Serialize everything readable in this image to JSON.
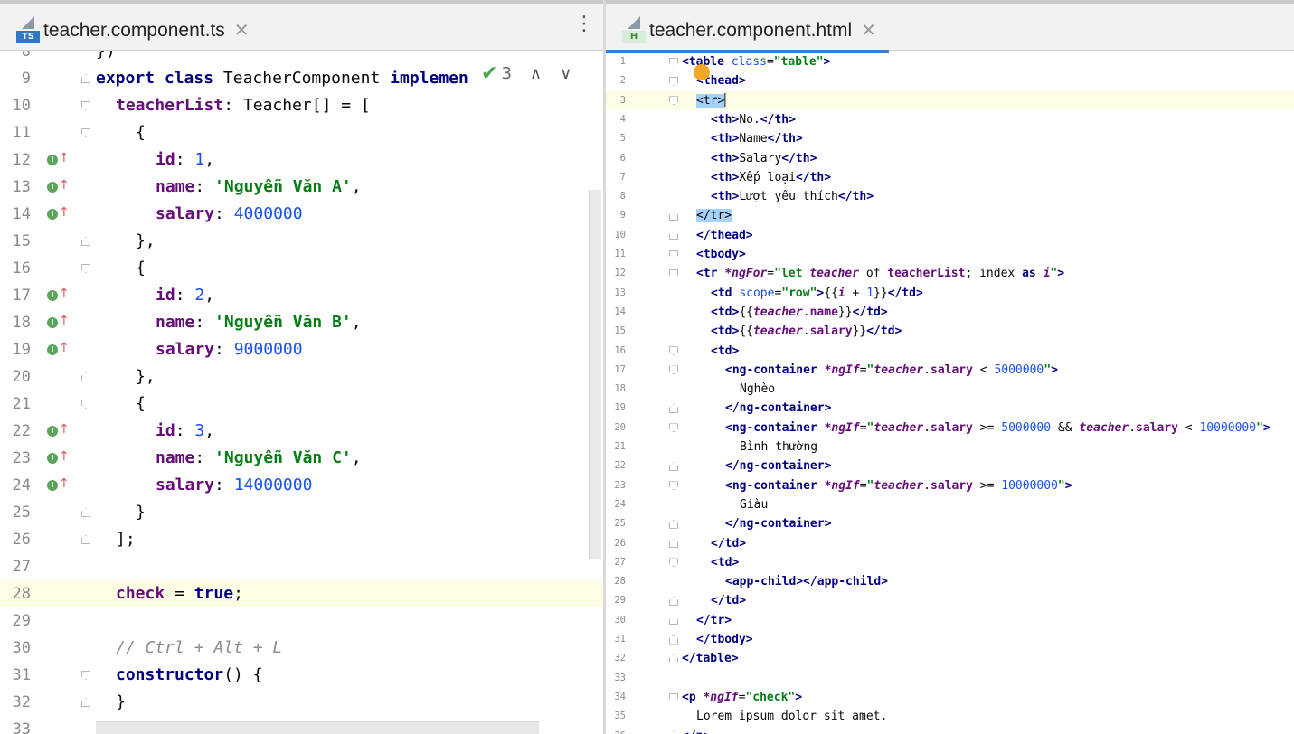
{
  "left": {
    "tab": {
      "icon_label": "TS",
      "name": "teacher.component.ts",
      "close": "✕"
    },
    "inspections": {
      "count": "3"
    },
    "lines": [
      {
        "n": "8",
        "fold": "",
        "impl": false,
        "indent": 0,
        "tokens": [
          [
            "plain",
            "})"
          ]
        ]
      },
      {
        "n": "9",
        "fold": "end",
        "impl": false,
        "indent": 0,
        "tokens": [
          [
            "kw",
            "export"
          ],
          [
            "plain",
            " "
          ],
          [
            "kw",
            "class"
          ],
          [
            "plain",
            " TeacherComponent "
          ],
          [
            "kw",
            "implemen"
          ]
        ]
      },
      {
        "n": "10",
        "fold": "start",
        "impl": false,
        "indent": 1,
        "tokens": [
          [
            "prop",
            "teacherList"
          ],
          [
            "plain",
            ": Teacher[] = ["
          ]
        ]
      },
      {
        "n": "11",
        "fold": "start",
        "impl": false,
        "indent": 2,
        "tokens": [
          [
            "plain",
            "{"
          ]
        ]
      },
      {
        "n": "12",
        "fold": "",
        "impl": true,
        "indent": 3,
        "tokens": [
          [
            "prop",
            "id"
          ],
          [
            "plain",
            ": "
          ],
          [
            "num-l",
            "1"
          ],
          [
            "plain",
            ","
          ]
        ]
      },
      {
        "n": "13",
        "fold": "",
        "impl": true,
        "indent": 3,
        "tokens": [
          [
            "prop",
            "name"
          ],
          [
            "plain",
            ": "
          ],
          [
            "str",
            "'Nguyễn Văn A'"
          ],
          [
            "plain",
            ","
          ]
        ]
      },
      {
        "n": "14",
        "fold": "",
        "impl": true,
        "indent": 3,
        "tokens": [
          [
            "prop",
            "salary"
          ],
          [
            "plain",
            ": "
          ],
          [
            "num-l",
            "4000000"
          ]
        ]
      },
      {
        "n": "15",
        "fold": "end",
        "impl": false,
        "indent": 2,
        "tokens": [
          [
            "plain",
            "},"
          ]
        ]
      },
      {
        "n": "16",
        "fold": "start",
        "impl": false,
        "indent": 2,
        "tokens": [
          [
            "plain",
            "{"
          ]
        ]
      },
      {
        "n": "17",
        "fold": "",
        "impl": true,
        "indent": 3,
        "tokens": [
          [
            "prop",
            "id"
          ],
          [
            "plain",
            ": "
          ],
          [
            "num-l",
            "2"
          ],
          [
            "plain",
            ","
          ]
        ]
      },
      {
        "n": "18",
        "fold": "",
        "impl": true,
        "indent": 3,
        "tokens": [
          [
            "prop",
            "name"
          ],
          [
            "plain",
            ": "
          ],
          [
            "str",
            "'Nguyễn Văn B'"
          ],
          [
            "plain",
            ","
          ]
        ]
      },
      {
        "n": "19",
        "fold": "",
        "impl": true,
        "indent": 3,
        "tokens": [
          [
            "prop",
            "salary"
          ],
          [
            "plain",
            ": "
          ],
          [
            "num-l",
            "9000000"
          ]
        ]
      },
      {
        "n": "20",
        "fold": "end",
        "impl": false,
        "indent": 2,
        "tokens": [
          [
            "plain",
            "},"
          ]
        ]
      },
      {
        "n": "21",
        "fold": "start",
        "impl": false,
        "indent": 2,
        "tokens": [
          [
            "plain",
            "{"
          ]
        ]
      },
      {
        "n": "22",
        "fold": "",
        "impl": true,
        "indent": 3,
        "tokens": [
          [
            "prop",
            "id"
          ],
          [
            "plain",
            ": "
          ],
          [
            "num-l",
            "3"
          ],
          [
            "plain",
            ","
          ]
        ]
      },
      {
        "n": "23",
        "fold": "",
        "impl": true,
        "indent": 3,
        "tokens": [
          [
            "prop",
            "name"
          ],
          [
            "plain",
            ": "
          ],
          [
            "str",
            "'Nguyễn Văn C'"
          ],
          [
            "plain",
            ","
          ]
        ]
      },
      {
        "n": "24",
        "fold": "",
        "impl": true,
        "indent": 3,
        "tokens": [
          [
            "prop",
            "salary"
          ],
          [
            "plain",
            ": "
          ],
          [
            "num-l",
            "14000000"
          ]
        ]
      },
      {
        "n": "25",
        "fold": "end",
        "impl": false,
        "indent": 2,
        "tokens": [
          [
            "plain",
            "}"
          ]
        ]
      },
      {
        "n": "26",
        "fold": "end",
        "impl": false,
        "indent": 1,
        "tokens": [
          [
            "plain",
            "];"
          ]
        ]
      },
      {
        "n": "27",
        "fold": "",
        "impl": false,
        "indent": 0,
        "tokens": []
      },
      {
        "n": "28",
        "fold": "",
        "impl": false,
        "indent": 1,
        "current": true,
        "tokens": [
          [
            "prop",
            "check"
          ],
          [
            "plain",
            " = "
          ],
          [
            "kw",
            "true"
          ],
          [
            "plain",
            ";"
          ]
        ]
      },
      {
        "n": "29",
        "fold": "",
        "impl": false,
        "indent": 0,
        "tokens": []
      },
      {
        "n": "30",
        "fold": "",
        "impl": false,
        "indent": 1,
        "tokens": [
          [
            "cmt",
            "// Ctrl + Alt + L"
          ]
        ]
      },
      {
        "n": "31",
        "fold": "start",
        "impl": false,
        "indent": 1,
        "tokens": [
          [
            "kw",
            "constructor"
          ],
          [
            "plain",
            "() {"
          ]
        ]
      },
      {
        "n": "32",
        "fold": "end",
        "impl": false,
        "indent": 1,
        "tokens": [
          [
            "plain",
            "}"
          ]
        ]
      },
      {
        "n": "33",
        "fold": "",
        "impl": false,
        "indent": 0,
        "tokens": []
      }
    ]
  },
  "right": {
    "tab": {
      "icon_label": "H",
      "name": "teacher.component.html",
      "close": "✕"
    },
    "lines": [
      {
        "n": "1",
        "fold": "start",
        "indent": 0,
        "tokens": [
          [
            "tag",
            "<table "
          ],
          [
            "attr",
            "class"
          ],
          [
            "plain",
            "="
          ],
          [
            "aval",
            "\"table\""
          ],
          [
            "tag",
            ">"
          ]
        ]
      },
      {
        "n": "2",
        "fold": "start",
        "indent": 1,
        "tokens": [
          [
            "tag",
            "<thead>"
          ]
        ]
      },
      {
        "n": "3",
        "fold": "start",
        "indent": 1,
        "current": true,
        "tokens": [
          [
            "selt",
            "<tr>"
          ],
          [
            "plain",
            "▏"
          ]
        ]
      },
      {
        "n": "4",
        "fold": "",
        "indent": 2,
        "tokens": [
          [
            "tag",
            "<th>"
          ],
          [
            "plain",
            "No."
          ],
          [
            "tag",
            "</th>"
          ]
        ]
      },
      {
        "n": "5",
        "fold": "",
        "indent": 2,
        "tokens": [
          [
            "tag",
            "<th>"
          ],
          [
            "plain",
            "Name"
          ],
          [
            "tag",
            "</th>"
          ]
        ]
      },
      {
        "n": "6",
        "fold": "",
        "indent": 2,
        "tokens": [
          [
            "tag",
            "<th>"
          ],
          [
            "plain",
            "Salary"
          ],
          [
            "tag",
            "</th>"
          ]
        ]
      },
      {
        "n": "7",
        "fold": "",
        "indent": 2,
        "tokens": [
          [
            "tag",
            "<th>"
          ],
          [
            "plain",
            "Xếp loại"
          ],
          [
            "tag",
            "</th>"
          ]
        ]
      },
      {
        "n": "8",
        "fold": "",
        "indent": 2,
        "tokens": [
          [
            "tag",
            "<th>"
          ],
          [
            "plain",
            "Lượt yêu thích"
          ],
          [
            "tag",
            "</th>"
          ]
        ]
      },
      {
        "n": "9",
        "fold": "end",
        "indent": 1,
        "tokens": [
          [
            "selt",
            "</tr>"
          ]
        ]
      },
      {
        "n": "10",
        "fold": "end",
        "indent": 1,
        "tokens": [
          [
            "tag",
            "</thead>"
          ]
        ]
      },
      {
        "n": "11",
        "fold": "start",
        "indent": 1,
        "tokens": [
          [
            "tag",
            "<tbody>"
          ]
        ]
      },
      {
        "n": "12",
        "fold": "start",
        "indent": 1,
        "tokens": [
          [
            "tag",
            "<tr "
          ],
          [
            "ivar",
            "*ngFor"
          ],
          [
            "plain",
            "="
          ],
          [
            "aval",
            "\"let "
          ],
          [
            "ivar",
            "teacher"
          ],
          [
            "plain",
            " of "
          ],
          [
            "prop",
            "teacherList"
          ],
          [
            "plain",
            "; index "
          ],
          [
            "kw",
            "as"
          ],
          [
            "plain",
            " "
          ],
          [
            "ivar",
            "i"
          ],
          [
            "aval",
            "\""
          ],
          [
            "tag",
            ">"
          ]
        ]
      },
      {
        "n": "13",
        "fold": "",
        "indent": 2,
        "tokens": [
          [
            "tag",
            "<td "
          ],
          [
            "attr",
            "scope"
          ],
          [
            "plain",
            "="
          ],
          [
            "aval",
            "\"row\""
          ],
          [
            "tag",
            ">"
          ],
          [
            "plain",
            "{{"
          ],
          [
            "ivar",
            "i"
          ],
          [
            "plain",
            " + "
          ],
          [
            "num-l",
            "1"
          ],
          [
            "plain",
            "}}"
          ],
          [
            "tag",
            "</td>"
          ]
        ]
      },
      {
        "n": "14",
        "fold": "",
        "indent": 2,
        "tokens": [
          [
            "tag",
            "<td>"
          ],
          [
            "plain",
            "{{"
          ],
          [
            "ivar",
            "teacher"
          ],
          [
            "plain",
            "."
          ],
          [
            "prop",
            "name"
          ],
          [
            "plain",
            "}}"
          ],
          [
            "tag",
            "</td>"
          ]
        ]
      },
      {
        "n": "15",
        "fold": "",
        "indent": 2,
        "tokens": [
          [
            "tag",
            "<td>"
          ],
          [
            "plain",
            "{{"
          ],
          [
            "ivar",
            "teacher"
          ],
          [
            "plain",
            "."
          ],
          [
            "prop",
            "salary"
          ],
          [
            "plain",
            "}}"
          ],
          [
            "tag",
            "</td>"
          ]
        ]
      },
      {
        "n": "16",
        "fold": "start",
        "indent": 2,
        "tokens": [
          [
            "tag",
            "<td>"
          ]
        ]
      },
      {
        "n": "17",
        "fold": "start",
        "indent": 3,
        "tokens": [
          [
            "tag",
            "<ng-container "
          ],
          [
            "ivar",
            "*ngIf"
          ],
          [
            "plain",
            "="
          ],
          [
            "aval",
            "\""
          ],
          [
            "ivar",
            "teacher"
          ],
          [
            "plain",
            "."
          ],
          [
            "prop",
            "salary"
          ],
          [
            "plain",
            " < "
          ],
          [
            "num-l",
            "5000000"
          ],
          [
            "aval",
            "\""
          ],
          [
            "tag",
            ">"
          ]
        ]
      },
      {
        "n": "18",
        "fold": "",
        "indent": 4,
        "tokens": [
          [
            "plain",
            "Nghèo"
          ]
        ]
      },
      {
        "n": "19",
        "fold": "end",
        "indent": 3,
        "tokens": [
          [
            "tag",
            "</ng-container>"
          ]
        ]
      },
      {
        "n": "20",
        "fold": "start",
        "indent": 3,
        "tokens": [
          [
            "tag",
            "<ng-container "
          ],
          [
            "ivar",
            "*ngIf"
          ],
          [
            "plain",
            "="
          ],
          [
            "aval",
            "\""
          ],
          [
            "ivar",
            "teacher"
          ],
          [
            "plain",
            "."
          ],
          [
            "prop",
            "salary"
          ],
          [
            "plain",
            " >= "
          ],
          [
            "num-l",
            "5000000"
          ],
          [
            "plain",
            " && "
          ],
          [
            "ivar",
            "teacher"
          ],
          [
            "plain",
            "."
          ],
          [
            "prop",
            "salary"
          ],
          [
            "plain",
            " < "
          ],
          [
            "num-l",
            "10000000"
          ],
          [
            "aval",
            "\""
          ],
          [
            "tag",
            ">"
          ]
        ]
      },
      {
        "n": "21",
        "fold": "",
        "indent": 4,
        "tokens": [
          [
            "plain",
            "Bình thường"
          ]
        ]
      },
      {
        "n": "22",
        "fold": "end",
        "indent": 3,
        "tokens": [
          [
            "tag",
            "</ng-container>"
          ]
        ]
      },
      {
        "n": "23",
        "fold": "start",
        "indent": 3,
        "tokens": [
          [
            "tag",
            "<ng-container "
          ],
          [
            "ivar",
            "*ngIf"
          ],
          [
            "plain",
            "="
          ],
          [
            "aval",
            "\""
          ],
          [
            "ivar",
            "teacher"
          ],
          [
            "plain",
            "."
          ],
          [
            "prop",
            "salary"
          ],
          [
            "plain",
            " >= "
          ],
          [
            "num-l",
            "10000000"
          ],
          [
            "aval",
            "\""
          ],
          [
            "tag",
            ">"
          ]
        ]
      },
      {
        "n": "24",
        "fold": "",
        "indent": 4,
        "tokens": [
          [
            "plain",
            "Giàu"
          ]
        ]
      },
      {
        "n": "25",
        "fold": "end",
        "indent": 3,
        "tokens": [
          [
            "tag",
            "</ng-container>"
          ]
        ]
      },
      {
        "n": "26",
        "fold": "end",
        "indent": 2,
        "tokens": [
          [
            "tag",
            "</td>"
          ]
        ]
      },
      {
        "n": "27",
        "fold": "start",
        "indent": 2,
        "tokens": [
          [
            "tag",
            "<td>"
          ]
        ]
      },
      {
        "n": "28",
        "fold": "",
        "indent": 3,
        "tokens": [
          [
            "tag",
            "<app-child></app-child>"
          ]
        ]
      },
      {
        "n": "29",
        "fold": "end",
        "indent": 2,
        "tokens": [
          [
            "tag",
            "</td>"
          ]
        ]
      },
      {
        "n": "30",
        "fold": "end",
        "indent": 1,
        "tokens": [
          [
            "tag",
            "</tr>"
          ]
        ]
      },
      {
        "n": "31",
        "fold": "end",
        "indent": 1,
        "tokens": [
          [
            "tag",
            "</tbody>"
          ]
        ]
      },
      {
        "n": "32",
        "fold": "end",
        "indent": 0,
        "tokens": [
          [
            "tag",
            "</table>"
          ]
        ]
      },
      {
        "n": "33",
        "fold": "",
        "indent": 0,
        "tokens": []
      },
      {
        "n": "34",
        "fold": "start",
        "indent": 0,
        "tokens": [
          [
            "tag",
            "<p "
          ],
          [
            "ivar",
            "*ngIf"
          ],
          [
            "plain",
            "="
          ],
          [
            "aval",
            "\"check\""
          ],
          [
            "tag",
            ">"
          ]
        ]
      },
      {
        "n": "35",
        "fold": "",
        "indent": 1,
        "tokens": [
          [
            "plain",
            "Lorem ipsum dolor sit amet."
          ]
        ]
      },
      {
        "n": "36",
        "fold": "end",
        "indent": 0,
        "tokens": [
          [
            "tag",
            "</p>"
          ]
        ]
      }
    ]
  },
  "colors": {
    "ts_icon": "#2e79c7",
    "html_icon": "#3c8c3c",
    "active_tab": "#3d7cd6"
  }
}
